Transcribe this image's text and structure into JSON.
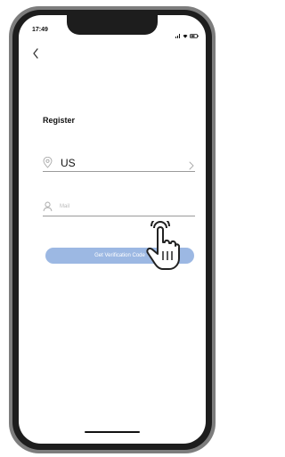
{
  "status_bar": {
    "time": "17:49"
  },
  "page": {
    "title": "Register"
  },
  "country": {
    "value": "US"
  },
  "mail": {
    "placeholder": "Mail"
  },
  "actions": {
    "verify_label": "Get Verification Code"
  },
  "colors": {
    "button": "#9cb8e3",
    "phone_frame": "#1d1d1d"
  },
  "icons": [
    "back-chevron-icon",
    "location-pin-icon",
    "chevron-right-icon",
    "person-icon",
    "pointer-hand-icon"
  ]
}
